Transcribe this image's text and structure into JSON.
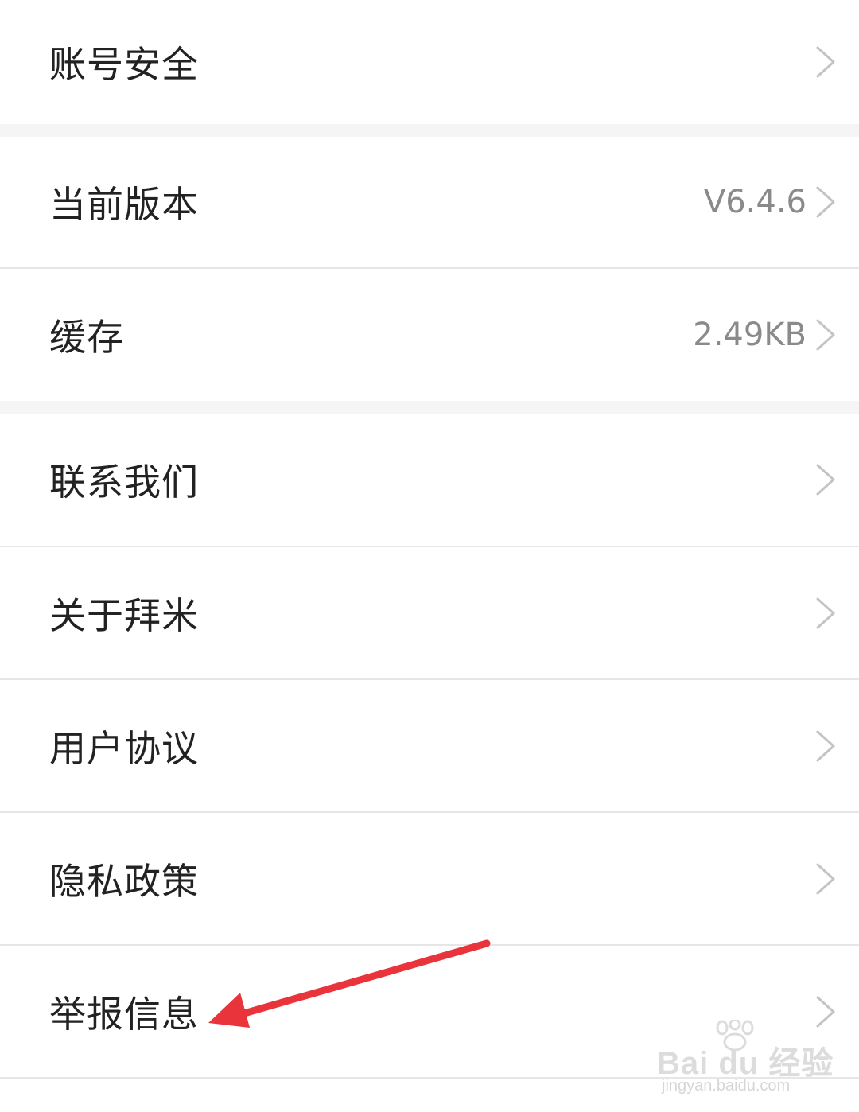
{
  "settings": {
    "items": [
      {
        "label": "账号安全",
        "value": ""
      },
      {
        "label": "当前版本",
        "value": "V6.4.6"
      },
      {
        "label": "缓存",
        "value": "2.49KB"
      },
      {
        "label": "联系我们",
        "value": ""
      },
      {
        "label": "关于拜米",
        "value": ""
      },
      {
        "label": "用户协议",
        "value": ""
      },
      {
        "label": "隐私政策",
        "value": ""
      },
      {
        "label": "举报信息",
        "value": ""
      }
    ]
  },
  "annotation": {
    "arrow_color": "#e8343a",
    "points_to": "举报信息"
  },
  "watermark": {
    "brand": "Bai du 经验",
    "url": "jingyan.baidu.com"
  },
  "colors": {
    "background": "#f5f5f5",
    "row": "#ffffff",
    "text": "#222222",
    "secondary": "#8a8a8a",
    "chevron": "#c4c4c4"
  },
  "icons": {
    "chevron": "chevron-right-icon"
  }
}
